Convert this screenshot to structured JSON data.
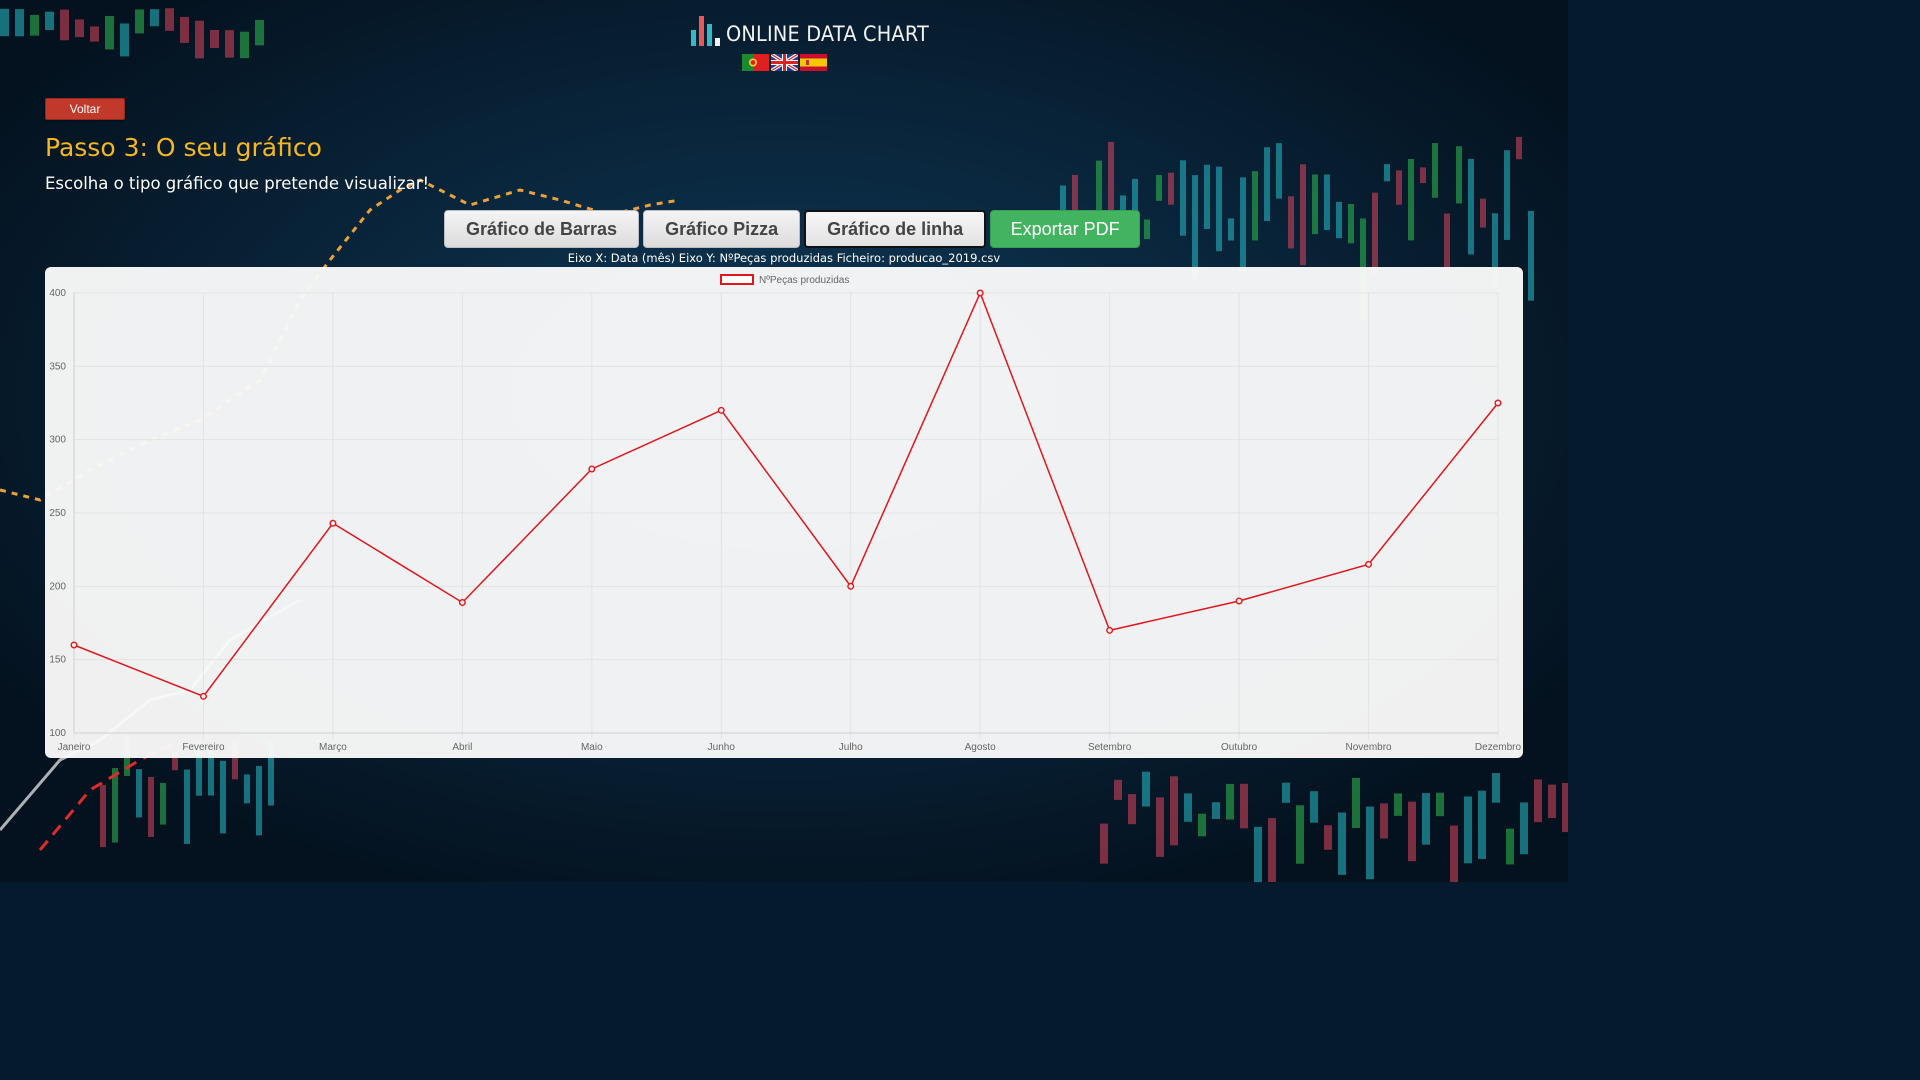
{
  "brand": {
    "name": "ONLINE DATA CHART"
  },
  "languages": [
    {
      "code": "pt",
      "icon": "portugal-flag-icon"
    },
    {
      "code": "en",
      "icon": "uk-flag-icon"
    },
    {
      "code": "es",
      "icon": "spain-flag-icon"
    }
  ],
  "nav": {
    "back_label": "Voltar"
  },
  "page": {
    "title": "Passo 3: O seu gráfico",
    "subtitle": "Escolha o tipo gráfico que pretende visualizar!"
  },
  "chart_types": [
    {
      "label": "Gráfico de Barras",
      "active": false
    },
    {
      "label": "Gráfico Pizza",
      "active": false
    },
    {
      "label": "Gráfico de linha",
      "active": true
    }
  ],
  "export": {
    "label": "Exportar PDF"
  },
  "axis_info": "Eixo X: Data (mês) Eixo Y: NºPeças produzidas Ficheiro: producao_2019.csv",
  "colors": {
    "title": "#f3b721",
    "series": "#e0181e",
    "export": "#42b35f",
    "back": "#c0392b"
  },
  "chart_data": {
    "type": "line",
    "categories": [
      "Janeiro",
      "Fevereiro",
      "Março",
      "Abril",
      "Maio",
      "Junho",
      "Julho",
      "Agosto",
      "Setembro",
      "Outubro",
      "Novembro",
      "Dezembro"
    ],
    "series": [
      {
        "name": "NºPeças produzidas",
        "values": [
          160,
          125,
          243,
          189,
          280,
          320,
          200,
          400,
          170,
          190,
          215,
          325
        ],
        "color": "#e0181e"
      }
    ],
    "ylim": [
      100,
      400
    ],
    "yticks": [
      100,
      150,
      200,
      250,
      300,
      350,
      400
    ],
    "grid": true,
    "legend": "top-center"
  }
}
